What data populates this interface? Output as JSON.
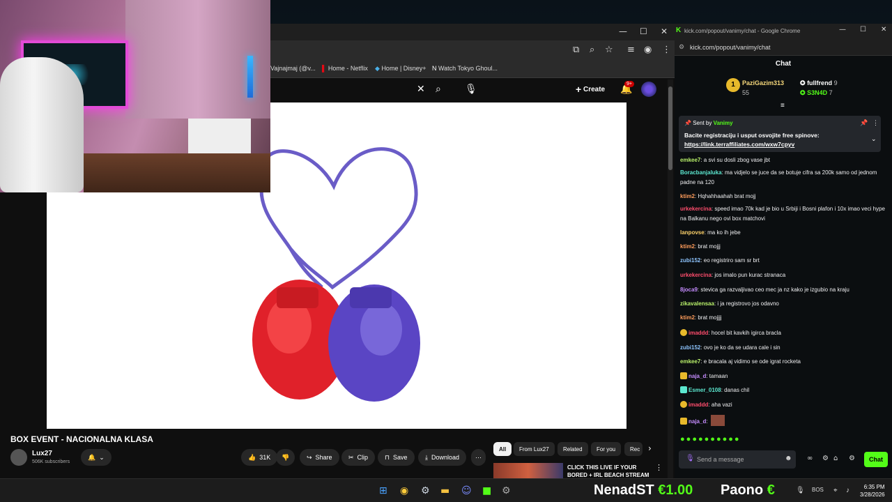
{
  "youtube_window": {
    "bookmarks": [
      "Vajnajmaj (@v...",
      "Home - Netflix",
      "Home | Disney+",
      "Watch Tokyo Ghoul..."
    ],
    "header": {
      "create_label": "Create",
      "notif_count": "9+"
    },
    "video": {
      "title": "BOX EVENT - NACIONALNA KLASA",
      "channel_name": "Lux27",
      "subscribers": "506K subscribers",
      "like_count": "31K",
      "share_label": "Share",
      "clip_label": "Clip",
      "save_label": "Save",
      "download_label": "Download"
    },
    "chips": [
      "All",
      "From Lux27",
      "Related",
      "For you",
      "Rec"
    ],
    "recommended": {
      "title": "CLICK THIS LIVE IF YOUR BORED + IRL BEACH STREAM"
    }
  },
  "chat_window": {
    "window_title": "kick.com/popout/vanimy/chat - Google Chrome",
    "url": "kick.com/popout/vanimy/chat",
    "header": "Chat",
    "leaderboard": [
      {
        "name": "PaziGazim313",
        "count": "55"
      },
      {
        "name": "fullfrend",
        "count": "9"
      },
      {
        "name": "S3N4D",
        "count": "7"
      }
    ],
    "pinned": {
      "sent_by_label": "Sent by",
      "sender": "Vanimy",
      "text": "Bacite registraciju i usput osvojite free spinove:",
      "link": "https://link.terraffiliates.com/wxw7cpyv"
    },
    "messages": [
      {
        "user": "emkee7",
        "text": ": a svi su dosli zbog vase jbt",
        "color": "#b8f06a"
      },
      {
        "user": "Boracbanjaluka",
        "text": ": ma vidjelo se juce da se botuje cifra sa 200k samo od jednom padne na 120",
        "color": "#5ce8d0"
      },
      {
        "user": "ktim2",
        "text": ": Hqhahhaahah brat mojj",
        "color": "#ff9d5c"
      },
      {
        "user": "urkekercina",
        "text": ": speed imao 70k kad je bio u Srbiji i Bosni plafon i 10x imao veci hype na Balkanu nego ovi box matchovi",
        "color": "#ff4d6d"
      },
      {
        "user": "lanpovse",
        "text": ": ma ko ih jebe",
        "color": "#ffd36b"
      },
      {
        "user": "ktim2",
        "text": ": brat mojjj",
        "color": "#ff9d5c"
      },
      {
        "user": "zubi152",
        "text": ": eo registriro sam sr brt",
        "color": "#8ec5ff"
      },
      {
        "user": "urkekercina",
        "text": ": jos imalo pun kurac stranaca",
        "color": "#ff4d6d"
      },
      {
        "user": "8joca9",
        "text": ": stevica ga razvaljivao ceo mec ja nz kako je izgubio na kraju",
        "color": "#c58cff"
      },
      {
        "user": "zikavalensaa",
        "text": ": i ja registrovo jos odavno",
        "color": "#b8f06a"
      },
      {
        "user": "ktim2",
        "text": ": brat mojjjj",
        "color": "#ff9d5c"
      },
      {
        "user": "imaddd",
        "text": ": hocel bit kavkih igirca bracla",
        "color": "#ff4d6d"
      },
      {
        "user": "zubi152",
        "text": ": ovo je ko da se udara cale i sin",
        "color": "#8ec5ff"
      },
      {
        "user": "emkee7",
        "text": ": e bracala aj vidimo se ode igrat rocketa",
        "color": "#b8f06a"
      },
      {
        "user": "naja_d",
        "text": ": tamaan",
        "color": "#c58cff"
      },
      {
        "user": "Esmer_0108",
        "text": ": danas chil",
        "color": "#5ce8d0"
      },
      {
        "user": "imaddd",
        "text": ": aha vazi",
        "color": "#ff4d6d"
      },
      {
        "user": "naja_d",
        "text": ":",
        "color": "#c58cff"
      }
    ],
    "input_placeholder": "Send a message",
    "send_label": "Chat"
  },
  "taskbar": {
    "donations": [
      {
        "name": "NenadST",
        "amount": "€1.00"
      },
      {
        "name": "Paono",
        "amount": "€"
      }
    ],
    "tray_lang": "BOS",
    "time": "6:35 PM",
    "date": "3/28/2026"
  }
}
